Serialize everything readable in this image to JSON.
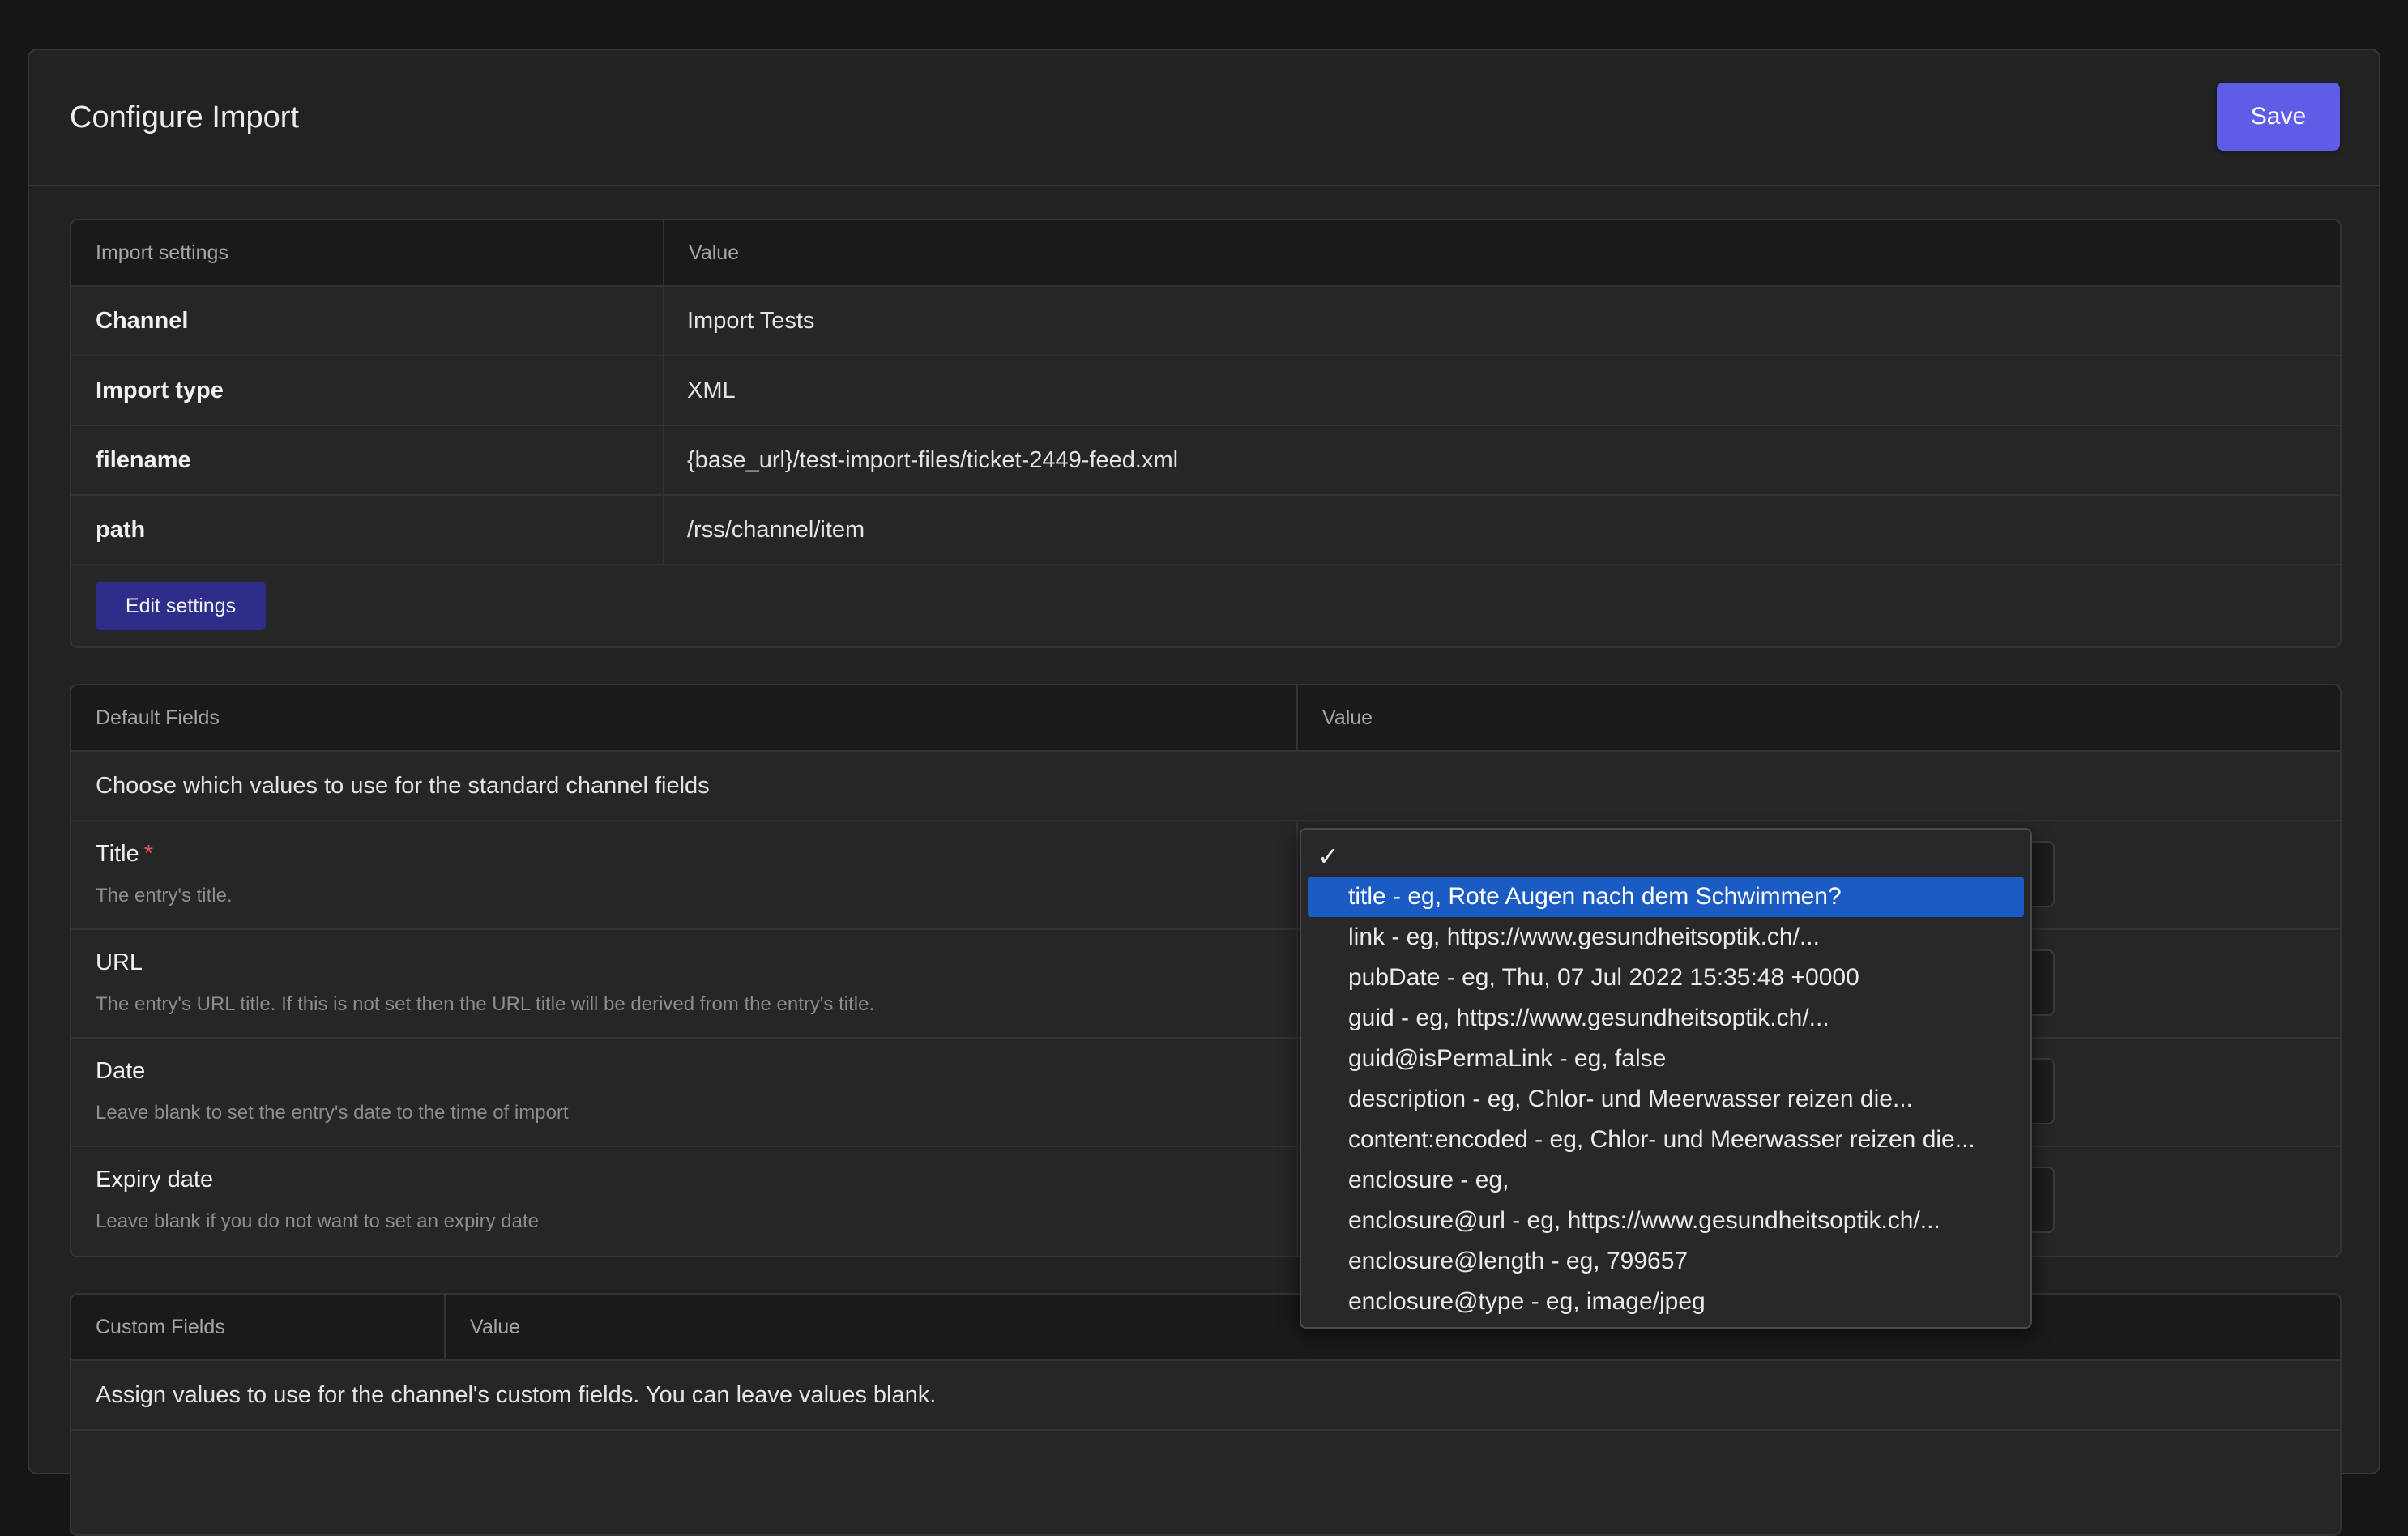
{
  "header": {
    "title": "Configure Import",
    "save_label": "Save"
  },
  "import_settings": {
    "col_setting": "Import settings",
    "col_value": "Value",
    "rows": [
      {
        "label": "Channel",
        "value": "Import Tests"
      },
      {
        "label": "Import type",
        "value": "XML"
      },
      {
        "label": "filename",
        "value": "{base_url}/test-import-files/ticket-2449-feed.xml"
      },
      {
        "label": "path",
        "value": "/rss/channel/item"
      }
    ],
    "edit_label": "Edit settings"
  },
  "default_fields": {
    "col_field": "Default Fields",
    "col_value": "Value",
    "intro": "Choose which values to use for the standard channel fields",
    "required_marker": "*",
    "fields": [
      {
        "name": "Title",
        "desc": "The entry's title."
      },
      {
        "name": "URL",
        "desc": "The entry's URL title. If this is not set then the URL title will be derived from the entry's title."
      },
      {
        "name": "Date",
        "desc": "Leave blank to set the entry's date to the time of import"
      },
      {
        "name": "Expiry date",
        "desc": "Leave blank if you do not want to set an expiry date"
      }
    ]
  },
  "custom_fields": {
    "col_field": "Custom Fields",
    "col_value": "Value",
    "intro": "Assign values to use for the channel's custom fields. You can leave values blank."
  },
  "dropdown": {
    "check_mark": "✓",
    "selected_index": 0,
    "options": [
      "title - eg, Rote Augen nach dem Schwimmen?",
      "link - eg, https://www.gesundheitsoptik.ch/...",
      "pubDate - eg, Thu, 07 Jul 2022 15:35:48 +0000",
      "guid - eg, https://www.gesundheitsoptik.ch/...",
      "guid@isPermaLink - eg, false",
      "description - eg, Chlor- und Meerwasser reizen die...",
      "content:encoded - eg, Chlor- und Meerwasser reizen die...",
      "enclosure - eg,",
      "enclosure@url - eg, https://www.gesundheitsoptik.ch/...",
      "enclosure@length - eg, 799657",
      "enclosure@type - eg, image/jpeg"
    ]
  },
  "colors": {
    "accent": "#5f5ce8",
    "edit_button": "#2e2e8a",
    "selection": "#1b5bc4",
    "required": "#e05561"
  }
}
